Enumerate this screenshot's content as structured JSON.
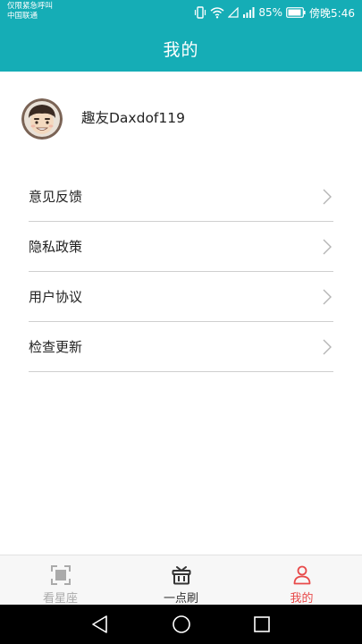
{
  "status_bar": {
    "carrier_line1": "仅限紧急呼叫",
    "carrier_line2": "中国联通",
    "battery": "85%",
    "time": "傍晚5:46"
  },
  "header": {
    "title": "我的"
  },
  "profile": {
    "username": "趣友Daxdof119"
  },
  "menu": {
    "items": [
      {
        "label": "意见反馈"
      },
      {
        "label": "隐私政策"
      },
      {
        "label": "用户协议"
      },
      {
        "label": "检查更新"
      }
    ]
  },
  "tab_bar": {
    "tabs": [
      {
        "label": "看星座",
        "icon": "scan-frame-icon",
        "active": false
      },
      {
        "label": "一点刷",
        "icon": "gift-box-icon",
        "active": false
      },
      {
        "label": "我的",
        "icon": "user-icon",
        "active": true
      }
    ]
  },
  "colors": {
    "primary": "#15adb6",
    "active_tab": "#e84a4a",
    "inactive_tab": "#aaaaaa",
    "dark_tab": "#333333"
  }
}
